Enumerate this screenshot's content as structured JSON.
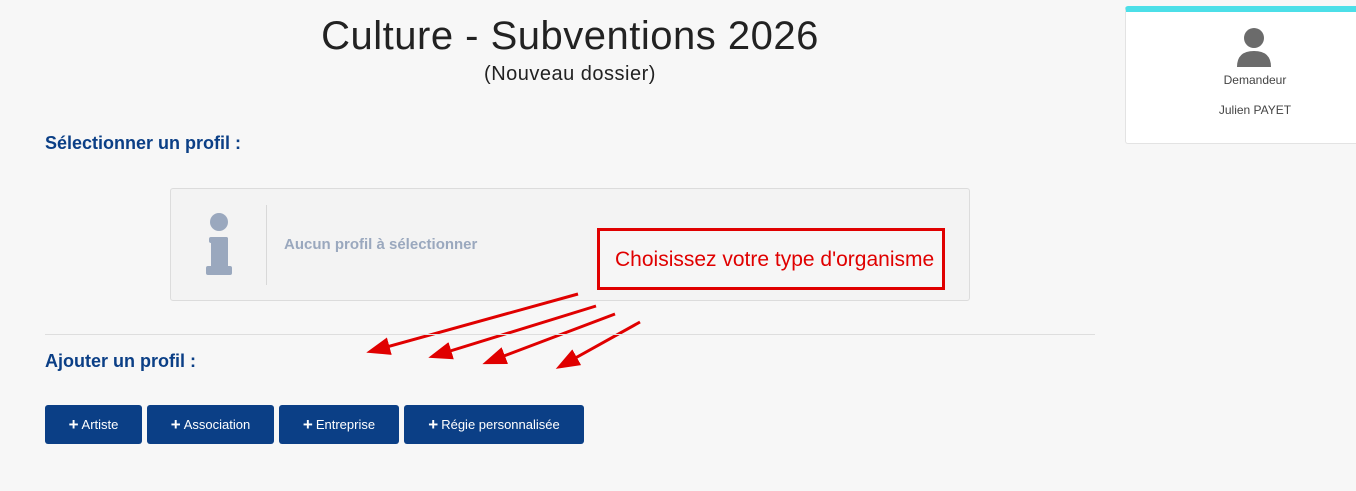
{
  "header": {
    "title": "Culture - Subventions 2026",
    "subtitle": "(Nouveau dossier)"
  },
  "select_section": {
    "heading": "Sélectionner un profil :",
    "empty_message": "Aucun profil à sélectionner",
    "icon": "info-icon"
  },
  "annotation": {
    "callout_text": "Choisissez votre type d'organisme",
    "color": "#e00000"
  },
  "add_section": {
    "heading": "Ajouter un profil :",
    "buttons": [
      {
        "label": "Artiste",
        "icon": "plus-icon"
      },
      {
        "label": "Association",
        "icon": "plus-icon"
      },
      {
        "label": "Entreprise",
        "icon": "plus-icon"
      },
      {
        "label": "Régie personnalisée",
        "icon": "plus-icon"
      }
    ]
  },
  "user_card": {
    "role": "Demandeur",
    "name": "Julien PAYET",
    "icon": "user-icon"
  },
  "colors": {
    "primary": "#0b3f86",
    "accent": "#4cdfe8",
    "background": "#f7f7f7"
  }
}
